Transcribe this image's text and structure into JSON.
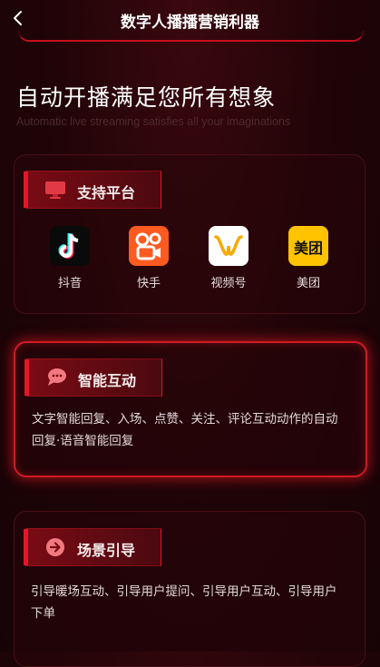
{
  "header": {
    "title": "数字人播播营销利器"
  },
  "hero": {
    "headline": "自动开播满足您所有想象",
    "subline": "Automatic live streaming satisfies all your imaginations"
  },
  "platforms": {
    "tag": "支持平台",
    "items": [
      {
        "label": "抖音",
        "icon": "douyin-icon"
      },
      {
        "label": "快手",
        "icon": "kuaishou-icon"
      },
      {
        "label": "视频号",
        "icon": "channels-icon"
      },
      {
        "label": "美团",
        "icon": "meituan-icon",
        "icon_text": "美团"
      }
    ]
  },
  "interaction": {
    "tag": "智能互动",
    "desc": "文字智能回复、入场、点赞、关注、评论互动动作的自动回复·语音智能回复"
  },
  "guide": {
    "tag": "场景引导",
    "desc": "引导暖场互动、引导用户提问、引导用户互动、引导用户下单"
  },
  "colors": {
    "accent": "#d01a26",
    "background": "#1a0306"
  }
}
